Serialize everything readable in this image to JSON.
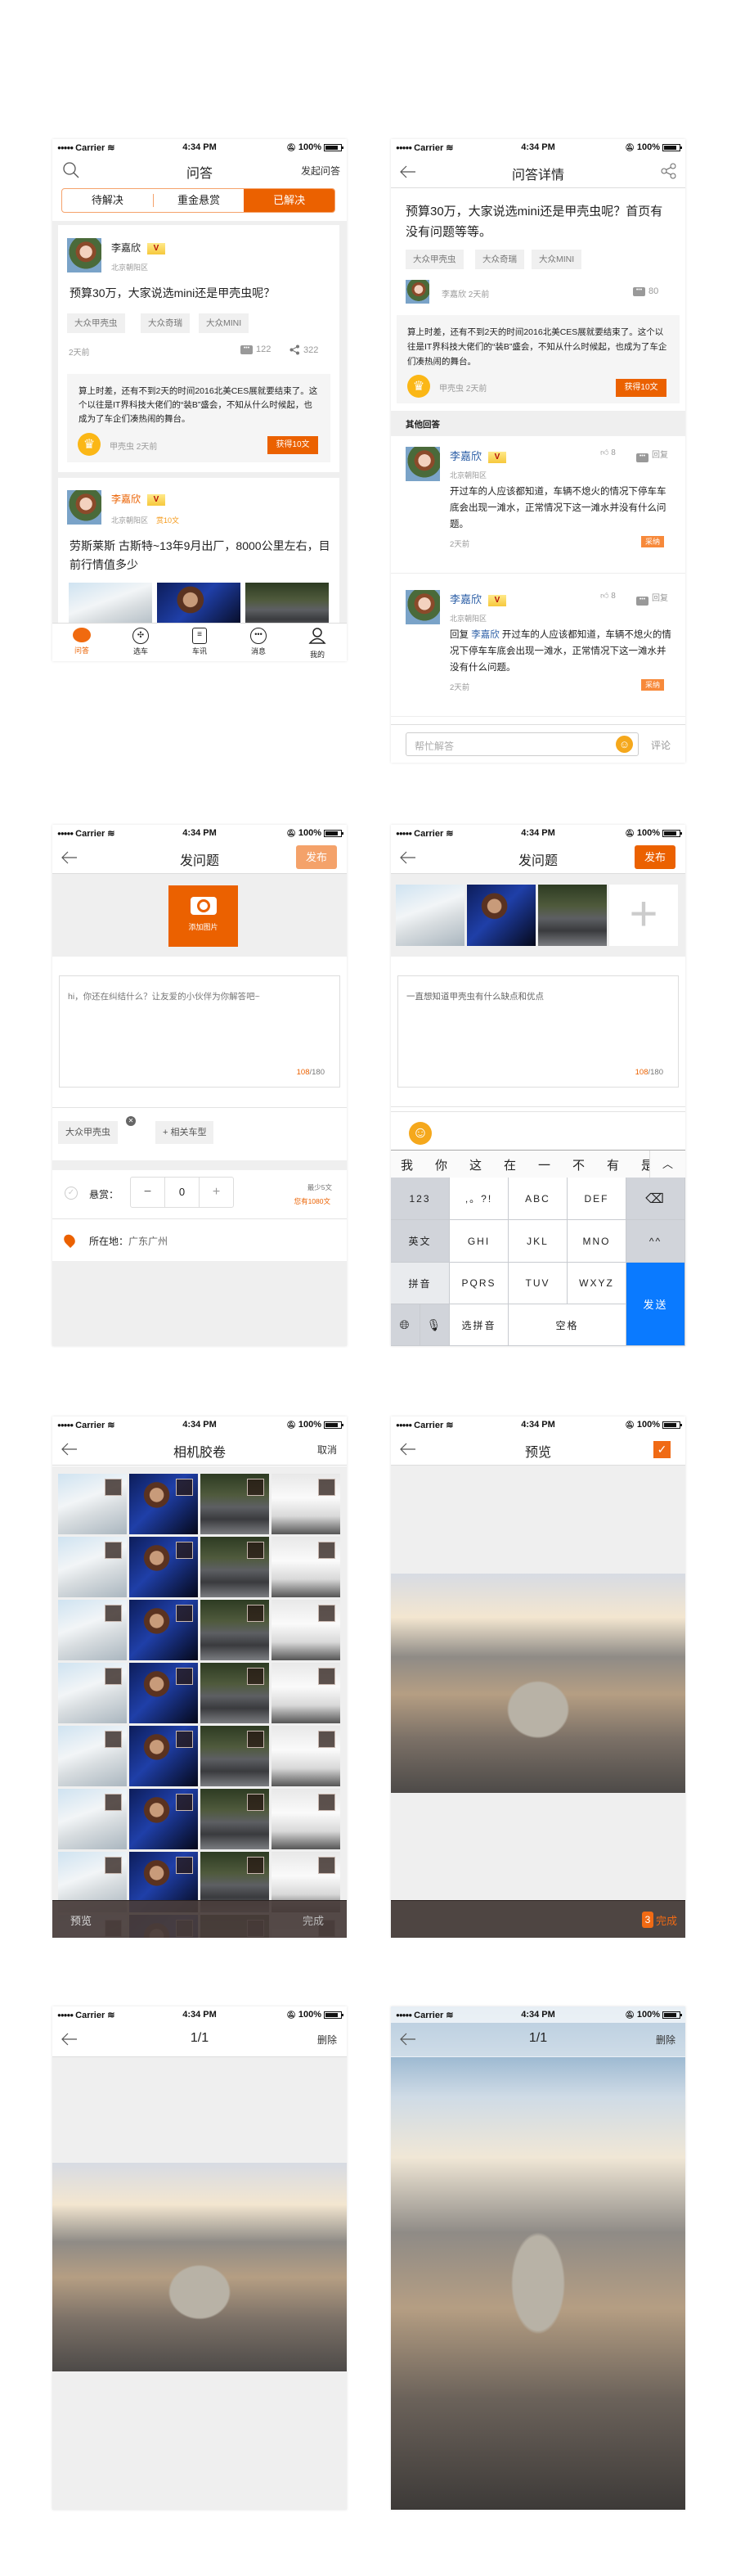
{
  "status": {
    "carrier": "Carrier",
    "time": "4:34 PM",
    "battery": "100%"
  },
  "colors": {
    "accent": "#eb6100",
    "blue_name": "#2b5ea6",
    "keyboard_send": "#0a7aff",
    "gold": "#fbb716"
  },
  "qa_list": {
    "title": "问答",
    "ask": "发起问答",
    "segments": [
      "待解决",
      "重金悬赏",
      "已解决"
    ],
    "active_segment": 2,
    "card1": {
      "user": "李嘉欣",
      "vip": "V",
      "location": "北京朝阳区",
      "title": "预算30万，大家说选mini还是甲壳虫呢？",
      "tags": [
        "大众甲壳虫",
        "大众奇瑞",
        "大众MINI"
      ],
      "time": "2天前",
      "comments": "122",
      "shares": "322",
      "answer": {
        "text": "算上时差，还有不到2天的时间2016北美CES展就要结束了。这个以往是IT界科技大佬们的“装B”盛会，不知从什么时候起，也成为了车企们凑热闹的舞台。",
        "author": "甲壳虫",
        "time": "2天前",
        "reward": "获得10文"
      }
    },
    "card2": {
      "user": "李嘉欣",
      "vip": "V",
      "location": "北京朝阳区",
      "bounty": "赏10文",
      "title": "劳斯莱斯 古斯特~13年9月出厂，8000公里左右，目前行情值多少"
    },
    "tabs": [
      "问答",
      "选车",
      "车讯",
      "消息",
      "我的"
    ]
  },
  "qa_detail": {
    "title": "问答详情",
    "question": "预算30万，大家说选mini还是甲壳虫呢？首页有没有问题等等。",
    "tags": [
      "大众甲壳虫",
      "大众奇瑞",
      "大众MINI"
    ],
    "asker": "李嘉欣",
    "asker_time": "2天前",
    "comments": "80",
    "best": {
      "text": "算上时差，还有不到2天的时间2016北美CES展就要结束了。这个以往是IT界科技大佬们的“装B”盛会，不知从什么时候起，也成为了车企们凑热闹的舞台。",
      "author": "甲壳虫",
      "time": "2天前",
      "reward": "获得10文"
    },
    "other_header": "其他回答",
    "answers": [
      {
        "user": "李嘉欣",
        "vip": "V",
        "location": "北京朝阳区",
        "likes": "8",
        "reply": "回复",
        "text": "开过车的人应该都知道，车辆不熄火的情况下停车车底会出现一滩水，正常情况下这一滩水并没有什么问题。",
        "time": "2天前",
        "adopt": "采纳"
      },
      {
        "user": "李嘉欣",
        "vip": "V",
        "location": "北京朝阳区",
        "likes": "8",
        "reply": "回复",
        "reply_prefix": "回复",
        "reply_to": "李嘉欣",
        "text": "开过车的人应该都知道，车辆不熄火的情况下停车车底会出现一滩水，正常情况下这一滩水并没有什么问题。",
        "time": "2天前",
        "adopt": "采纳"
      }
    ],
    "input_placeholder": "帮忙解答",
    "comment": "评论"
  },
  "ask_empty": {
    "title": "发问题",
    "publish": "发布",
    "add_photo": "添加图片",
    "placeholder": "hi，你还在纠结什么？让友爱的小伙伴为你解答吧~",
    "count": "108",
    "max": "/180",
    "tag": "大众甲壳虫",
    "add_model": "+ 相关车型",
    "reward_label": "悬赏：",
    "reward_value": "0",
    "minus": "−",
    "plus": "+",
    "min_note": "最少5文",
    "balance": "您有1080文",
    "location_label": "所在地：",
    "location": "广东广州"
  },
  "ask_filled": {
    "title": "发问题",
    "publish": "发布",
    "text": "一直想知道甲壳虫有什么缺点和优点",
    "count": "108",
    "max": "/180",
    "candidates": [
      "我",
      "你",
      "这",
      "在",
      "一",
      "不",
      "有",
      "是"
    ],
    "keys": {
      "k123": "123",
      "punct": ",。?!",
      "abc": "ABC",
      "def": "DEF",
      "en": "英文",
      "ghi": "GHI",
      "jkl": "JKL",
      "mno": "MNO",
      "face": "^^",
      "pinyin": "拼音",
      "pqrs": "PQRS",
      "tuv": "TUV",
      "wxyz": "WXYZ",
      "choose": "选拼音",
      "space": "空格",
      "send": "发送"
    }
  },
  "camera_roll": {
    "title": "相机胶卷",
    "cancel": "取消",
    "preview": "预览",
    "done": "完成"
  },
  "preview": {
    "title": "预览",
    "count": "3",
    "done": "完成"
  },
  "viewer": {
    "page": "1/1",
    "delete": "删除"
  },
  "viewer_full": {
    "page": "1/1",
    "delete": "删除"
  }
}
